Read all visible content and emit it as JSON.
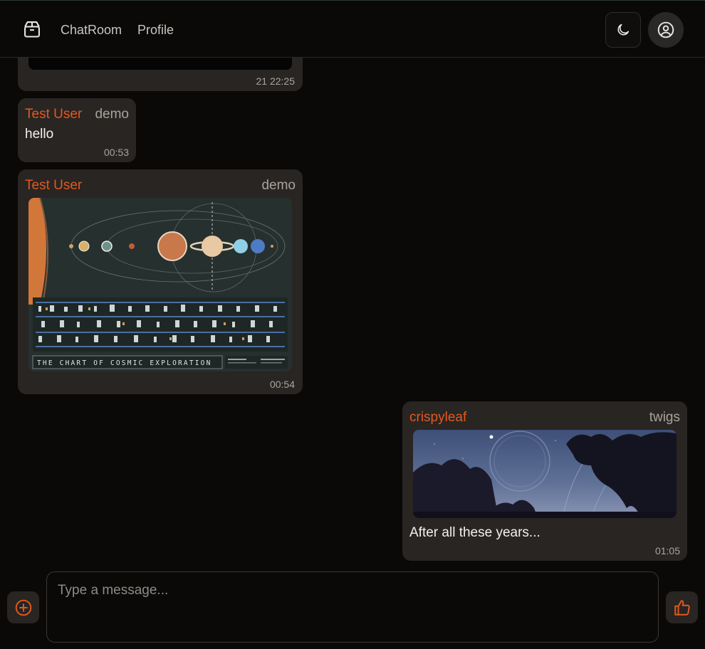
{
  "header": {
    "logo_icon": "package-box-icon",
    "nav": [
      {
        "label": "ChatRoom"
      },
      {
        "label": "Profile"
      }
    ],
    "theme_icon": "moon-icon",
    "user_icon": "user-circle-icon"
  },
  "messages": [
    {
      "time": "21 22:25"
    },
    {
      "sender": "Test User",
      "handle": "demo",
      "text": "hello",
      "time": "00:53"
    },
    {
      "sender": "Test User",
      "handle": "demo",
      "image_caption": "THE CHART OF COSMIC EXPLORATION",
      "time": "00:54"
    },
    {
      "sender": "crispyleaf",
      "handle": "twigs",
      "text": "After all these years...",
      "time": "01:05"
    }
  ],
  "composer": {
    "placeholder": "Type a message...",
    "add_icon": "plus-circle-icon",
    "like_icon": "thumbs-up-icon"
  },
  "colors": {
    "background": "#0a0908",
    "bubble": "#282523",
    "accent": "#e2591f"
  }
}
